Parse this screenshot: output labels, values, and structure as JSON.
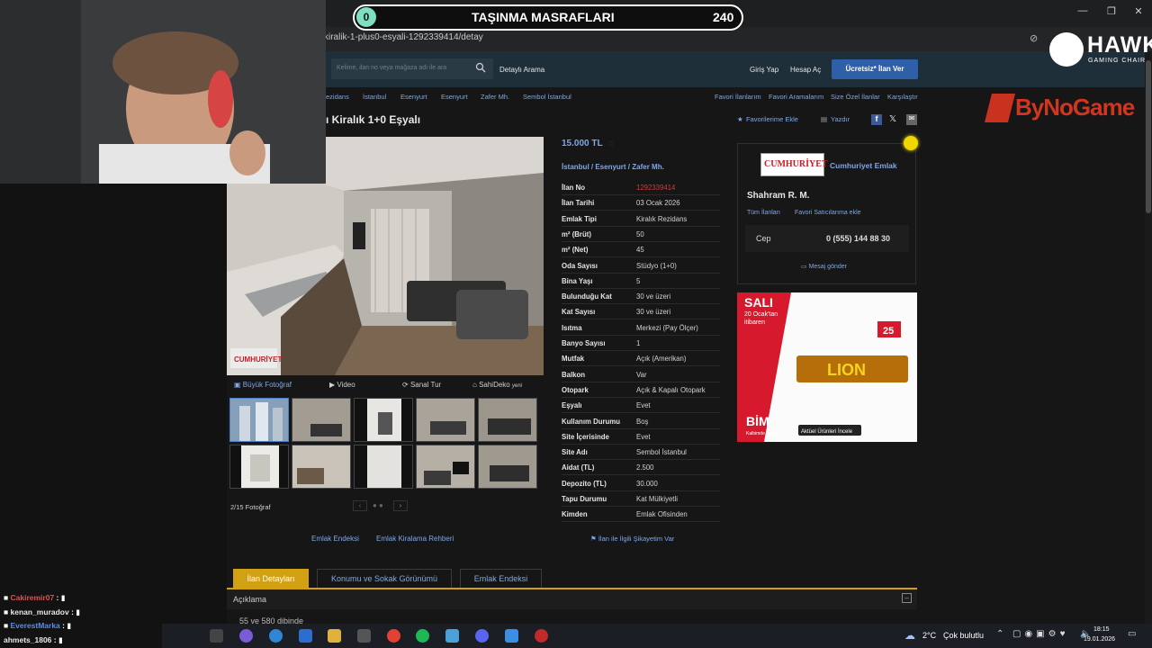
{
  "overlay": {
    "goal_badge": "0",
    "goal_title": "TAŞINMA MASRAFLARI",
    "goal_value": "240",
    "team_name": "HAWK",
    "team_sub": "GAMING CHAIR",
    "sponsor": "ByNoGame"
  },
  "browser": {
    "url": "kiralik-1-plus0-esyali-1292339414/detay"
  },
  "site_header": {
    "search_placeholder": "Kelime, ilan no veya mağaza adı ile ara",
    "detailed_search": "Detaylı Arama",
    "login": "Giriş Yap",
    "signup": "Hesap Aç",
    "post_ad": "Ücretsiz* İlan Ver"
  },
  "breadcrumb": [
    "ezidans",
    "İstanbul",
    "Esenyurt",
    "Esenyurt",
    "Zafer Mh.",
    "Sembol İstanbul"
  ],
  "top_links": [
    "Favori İlanlarım",
    "Favori Aramalarım",
    "Size Özel İlanlar",
    "Karşılaştır"
  ],
  "listing": {
    "title": "ı Kiralık 1+0 Eşyalı",
    "actions": {
      "favorite": "Favorilerime Ekle",
      "print": "Yazdır"
    },
    "price": "15.000 TL",
    "location": [
      "İstanbul",
      "Esenyurt",
      "Zafer Mh."
    ],
    "watermark": "CUMHURİYET",
    "media_tabs": [
      "Büyük Fotoğraf",
      "Video",
      "Sanal Tur",
      "SahiDeko"
    ],
    "media_new_badge": "yeni",
    "photo_count": "2/15 Fotoğraf",
    "specs": [
      {
        "k": "İlan No",
        "v": "1292339414"
      },
      {
        "k": "İlan Tarihi",
        "v": "03 Ocak 2026"
      },
      {
        "k": "Emlak Tipi",
        "v": "Kiralık Rezidans"
      },
      {
        "k": "m² (Brüt)",
        "v": "50"
      },
      {
        "k": "m² (Net)",
        "v": "45"
      },
      {
        "k": "Oda Sayısı",
        "v": "Stüdyo (1+0)"
      },
      {
        "k": "Bina Yaşı",
        "v": "5"
      },
      {
        "k": "Bulunduğu Kat",
        "v": "30 ve üzeri"
      },
      {
        "k": "Kat Sayısı",
        "v": "30 ve üzeri"
      },
      {
        "k": "Isıtma",
        "v": "Merkezi (Pay Ölçer)"
      },
      {
        "k": "Banyo Sayısı",
        "v": "1"
      },
      {
        "k": "Mutfak",
        "v": "Açık (Amerikan)"
      },
      {
        "k": "Balkon",
        "v": "Var"
      },
      {
        "k": "Otopark",
        "v": "Açık & Kapalı Otopark"
      },
      {
        "k": "Eşyalı",
        "v": "Evet"
      },
      {
        "k": "Kullanım Durumu",
        "v": "Boş"
      },
      {
        "k": "Site İçerisinde",
        "v": "Evet"
      },
      {
        "k": "Site Adı",
        "v": "Sembol İstanbul"
      },
      {
        "k": "Aidat (TL)",
        "v": "2.500"
      },
      {
        "k": "Depozito (TL)",
        "v": "30.000"
      },
      {
        "k": "Tapu Durumu",
        "v": "Kat Mülkiyetli"
      },
      {
        "k": "Kimden",
        "v": "Emlak Ofisinden"
      }
    ],
    "footer_links": [
      "Emlak Endeksi",
      "Emlak Kiralama Rehberi"
    ],
    "complaint": "İlan ile İlgili Şikayetim Var"
  },
  "seller": {
    "logo_text": "CUMHURİYET",
    "store_name": "Cumhuriyet Emlak",
    "agent": "Shahram R. M.",
    "all_ads": "Tüm İlanları",
    "add_fav": "Favori Satıcılarıma ekle",
    "phone_label": "Cep",
    "phone": "0 (555) 144 88 30",
    "message": "Mesaj gönder"
  },
  "ad": {
    "day": "SALI",
    "date_line": "20 Ocak'tan",
    "date_line2": "itibaren",
    "price": "25",
    "product": "LION",
    "brand": "BİM",
    "brand_sub": "Kalbimde Benim",
    "cta": "Aktüel Ürünleri İncele"
  },
  "tabs": [
    "İlan Detayları",
    "Konumu ve Sokak Görünümü",
    "Emlak Endeksi"
  ],
  "description": {
    "header": "Açıklama",
    "text": "55 ve 580 dibinde"
  },
  "chat": [
    {
      "user": "Cakiremir07",
      "color": "#e0524f"
    },
    {
      "user": "kenan_muradov",
      "color": "#e8e8e8"
    },
    {
      "user": "EverestMarka",
      "color": "#5b8de8"
    },
    {
      "user": "ahmets_1806",
      "color": "#e8e8e8"
    }
  ],
  "taskbar": {
    "weather_temp": "2°C",
    "weather_text": "Çok bulutlu",
    "time": "18:15",
    "date": "19.01.2026"
  }
}
